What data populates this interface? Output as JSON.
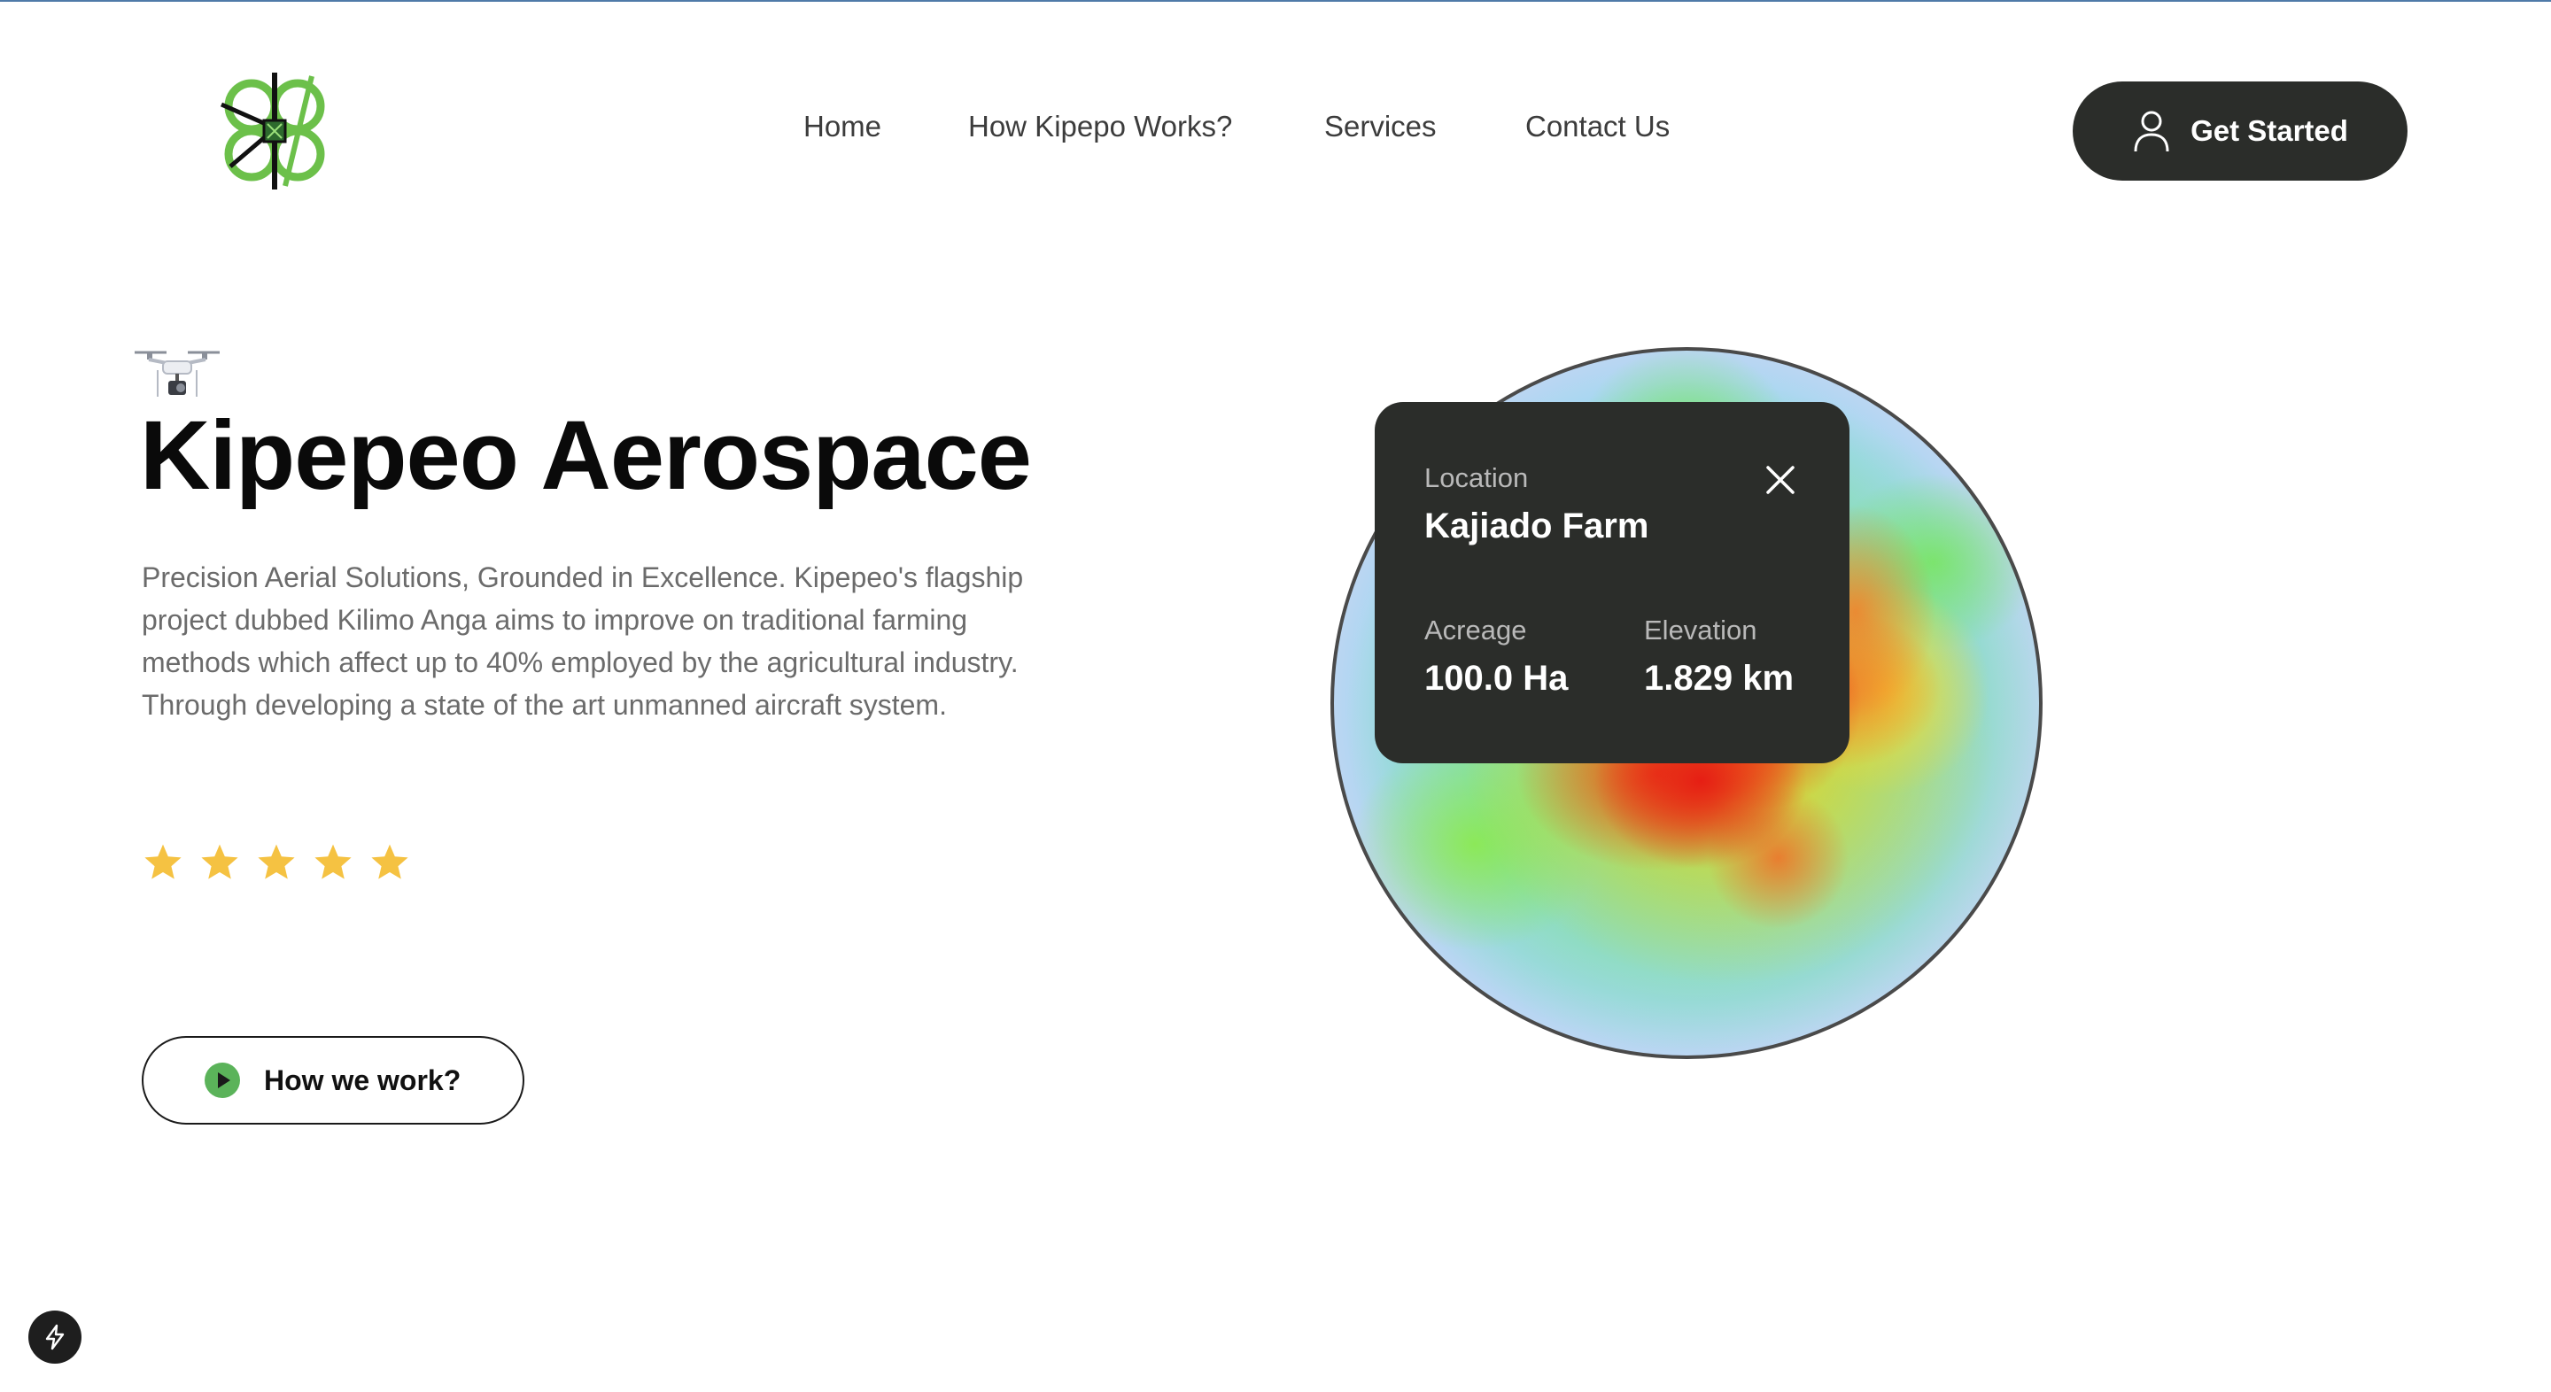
{
  "header": {
    "logo_icon": "drone-butterfly-logo",
    "nav": {
      "home": "Home",
      "how": "How Kipepo Works?",
      "services": "Services",
      "contact": "Contact Us"
    },
    "get_started": {
      "label": "Get Started",
      "icon": "user-icon"
    }
  },
  "hero": {
    "drone_icon": "drone-icon",
    "title": "Kipepeo Aerospace",
    "description": "Precision Aerial Solutions, Grounded in Excellence. Kipepeo's flagship project dubbed Kilimo Anga aims to improve on traditional farming methods which affect up to 40% employed by the agricultural industry. Through developing a state of the art unmanned aircraft system.",
    "rating": 5,
    "star_color": "#f5c242",
    "how_button": {
      "label": "How we work?",
      "icon": "play-icon",
      "icon_color": "#5bb35a"
    }
  },
  "map_card": {
    "location_label": "Location",
    "location_value": "Kajiado Farm",
    "acreage_label": "Acreage",
    "acreage_value": "100.0 Ha",
    "elevation_label": "Elevation",
    "elevation_value": "1.829 km",
    "close_icon": "close-icon"
  },
  "heatmap": {
    "type": "field-heatmap",
    "colors": [
      "#e61e14",
      "#f08228",
      "#fad228",
      "#6ee646",
      "#9fd8f0",
      "#f2f0fb"
    ]
  },
  "floating_badge": {
    "icon": "bolt-icon"
  },
  "colors": {
    "dark": "#2b2d2a",
    "logo_green": "#6cc04a",
    "text_muted": "#6b6b6b"
  }
}
